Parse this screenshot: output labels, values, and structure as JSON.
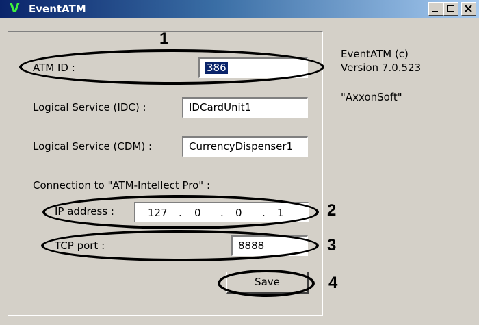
{
  "window": {
    "title": "EventATM",
    "icon_glyph": "V",
    "controls": {
      "minimize": "minimize-icon",
      "maximize": "maximize-icon",
      "close": "close-icon"
    }
  },
  "form": {
    "atm_id": {
      "label": "ATM ID :",
      "value": "386"
    },
    "idc": {
      "label": "Logical Service (IDC) :",
      "value": "IDCardUnit1"
    },
    "cdm": {
      "label": "Logical Service (CDM) :",
      "value": "CurrencyDispenser1"
    },
    "connection_heading": "Connection to \"ATM-Intellect Pro\" :",
    "ip": {
      "label": "IP address :",
      "octets": [
        "127",
        "0",
        "0",
        "1"
      ],
      "separator": "."
    },
    "tcp": {
      "label": "TCP port :",
      "value": "8888"
    },
    "save_label": "Save"
  },
  "info": {
    "line1": "EventATM (c)",
    "line2": "Version 7.0.523",
    "line3": "\"AxxonSoft\""
  },
  "annotations": {
    "n1": "1",
    "n2": "2",
    "n3": "3",
    "n4": "4"
  },
  "colors": {
    "title_start": "#0a246a",
    "title_end": "#a6caf0",
    "face": "#d4d0c8",
    "selection": "#0a246a"
  }
}
